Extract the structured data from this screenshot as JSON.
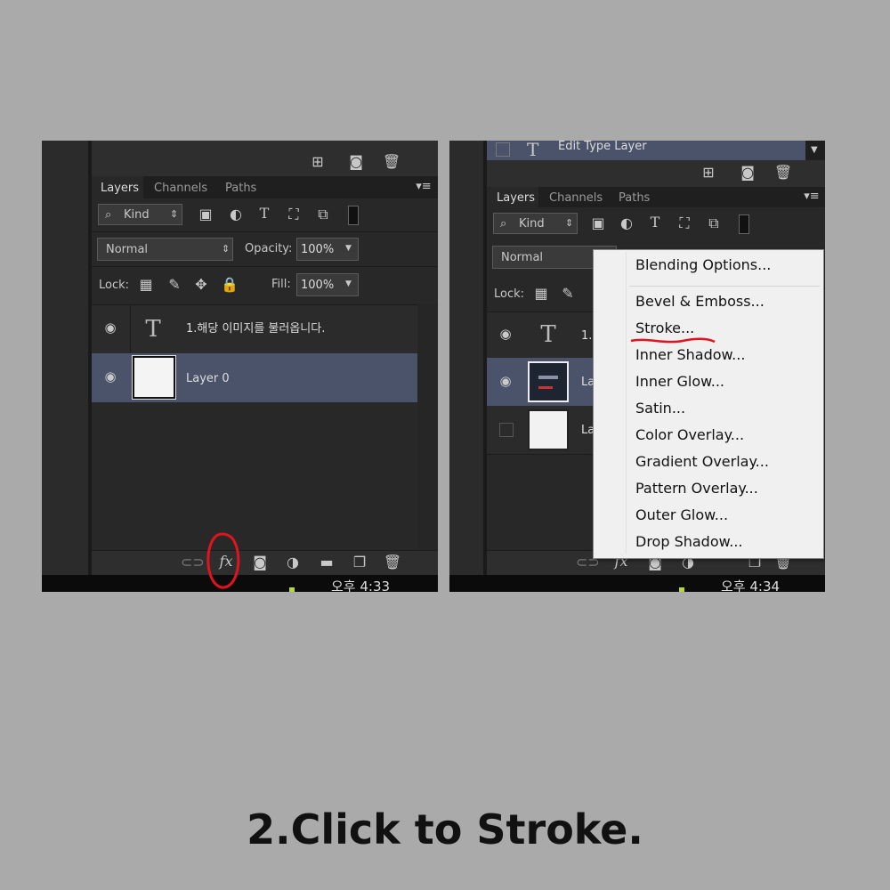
{
  "left_panel": {
    "tabs": [
      "Layers",
      "Channels",
      "Paths"
    ],
    "kind_label": "Kind",
    "blend_mode": "Normal",
    "opacity_label": "Opacity:",
    "opacity_value": "100%",
    "lock_label": "Lock:",
    "fill_label": "Fill:",
    "fill_value": "100%",
    "layers": [
      {
        "name": "1.해당 이미지를 불러옵니다.",
        "type": "text"
      },
      {
        "name": "Layer 0",
        "type": "image"
      }
    ],
    "clock": "오후 4:33"
  },
  "right_panel": {
    "top_layer": "Edit Type Layer",
    "tabs": [
      "Layers",
      "Channels",
      "Paths"
    ],
    "kind_label": "Kind",
    "blend_mode": "Normal",
    "lock_label": "Lock:",
    "layer_text_partial": "1.",
    "layer_img_partial_1": "La",
    "layer_img_partial_2": "La",
    "clock": "오후 4:34",
    "menu": {
      "items": [
        "Blending Options...",
        "Bevel & Emboss...",
        "Stroke...",
        "Inner Shadow...",
        "Inner Glow...",
        "Satin...",
        "Color Overlay...",
        "Gradient Overlay...",
        "Pattern Overlay...",
        "Outer Glow...",
        "Drop Shadow..."
      ],
      "highlighted": "Stroke..."
    }
  },
  "caption": "2.Click to Stroke.",
  "colors": {
    "annotation_red": "#e0141e",
    "selected_layer": "#4a5369",
    "panel_bg": "#282828"
  }
}
